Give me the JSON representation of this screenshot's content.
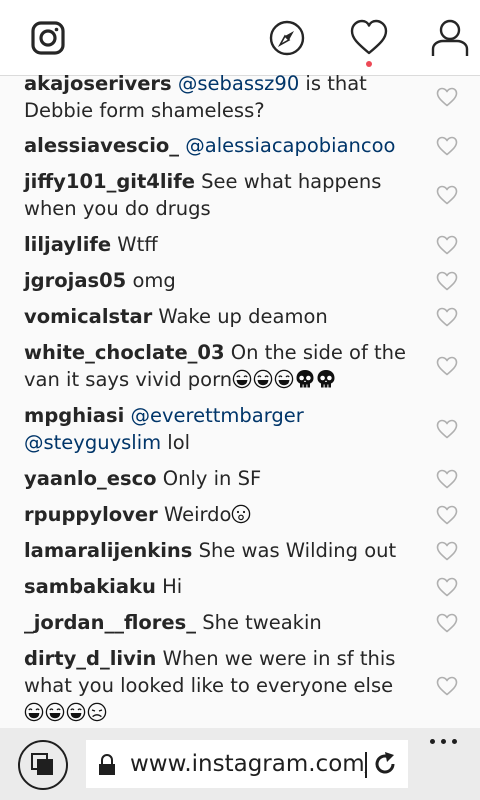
{
  "header": {
    "icons": [
      "instagram-logo-icon",
      "compass-explore-icon",
      "heart-activity-icon",
      "profile-icon"
    ],
    "notification_dot_color": "#ed4956"
  },
  "comments": [
    {
      "user": "akajoserivers",
      "parts": [
        {
          "t": "mention",
          "v": "@sebassz90"
        },
        {
          "t": "text",
          "v": " is that Debbie form shameless?"
        }
      ]
    },
    {
      "user": "alessiavescio_",
      "parts": [
        {
          "t": "mention",
          "v": "@alessiacapobiancoo"
        }
      ]
    },
    {
      "user": "jiffy101_git4life",
      "parts": [
        {
          "t": "text",
          "v": "See what happens when you do drugs"
        }
      ]
    },
    {
      "user": "liljaylife",
      "parts": [
        {
          "t": "text",
          "v": "Wtff"
        }
      ]
    },
    {
      "user": "jgrojas05",
      "parts": [
        {
          "t": "text",
          "v": "omg"
        }
      ]
    },
    {
      "user": "vomicalstar",
      "parts": [
        {
          "t": "text",
          "v": "Wake up deamon"
        }
      ]
    },
    {
      "user": "white_choclate_03",
      "parts": [
        {
          "t": "text",
          "v": "On the side of the van it says vivid porn"
        },
        {
          "t": "emoji",
          "v": "laugh"
        },
        {
          "t": "emoji",
          "v": "laugh"
        },
        {
          "t": "emoji",
          "v": "laugh"
        },
        {
          "t": "emoji",
          "v": "skull"
        },
        {
          "t": "emoji",
          "v": "skull"
        }
      ]
    },
    {
      "user": "mpghiasi",
      "parts": [
        {
          "t": "mention",
          "v": "@everettmbarger"
        },
        {
          "t": "text",
          "v": " "
        },
        {
          "t": "mention",
          "v": "@steyguyslim"
        },
        {
          "t": "text",
          "v": " lol"
        }
      ]
    },
    {
      "user": "yaanlo_esco",
      "parts": [
        {
          "t": "text",
          "v": "Only in SF"
        }
      ]
    },
    {
      "user": "rpuppylover",
      "parts": [
        {
          "t": "text",
          "v": "Weirdo"
        },
        {
          "t": "emoji",
          "v": "surprised"
        }
      ]
    },
    {
      "user": "lamaralijenkins",
      "parts": [
        {
          "t": "text",
          "v": "She was Wilding out"
        }
      ]
    },
    {
      "user": "sambakiaku",
      "parts": [
        {
          "t": "text",
          "v": "Hi"
        }
      ]
    },
    {
      "user": "_jordan__flores_",
      "parts": [
        {
          "t": "text",
          "v": "She tweakin"
        }
      ]
    },
    {
      "user": "dirty_d_livin",
      "parts": [
        {
          "t": "text",
          "v": "When we were in sf this what you looked like to everyone else "
        },
        {
          "t": "emoji",
          "v": "laugh"
        },
        {
          "t": "emoji",
          "v": "laugh"
        },
        {
          "t": "emoji",
          "v": "laugh"
        },
        {
          "t": "emoji",
          "v": "sad"
        }
      ]
    }
  ],
  "browser": {
    "url": "www.instagram.com/p/",
    "icons": [
      "tabs-icon",
      "lock-icon",
      "refresh-icon",
      "more-icon"
    ]
  }
}
